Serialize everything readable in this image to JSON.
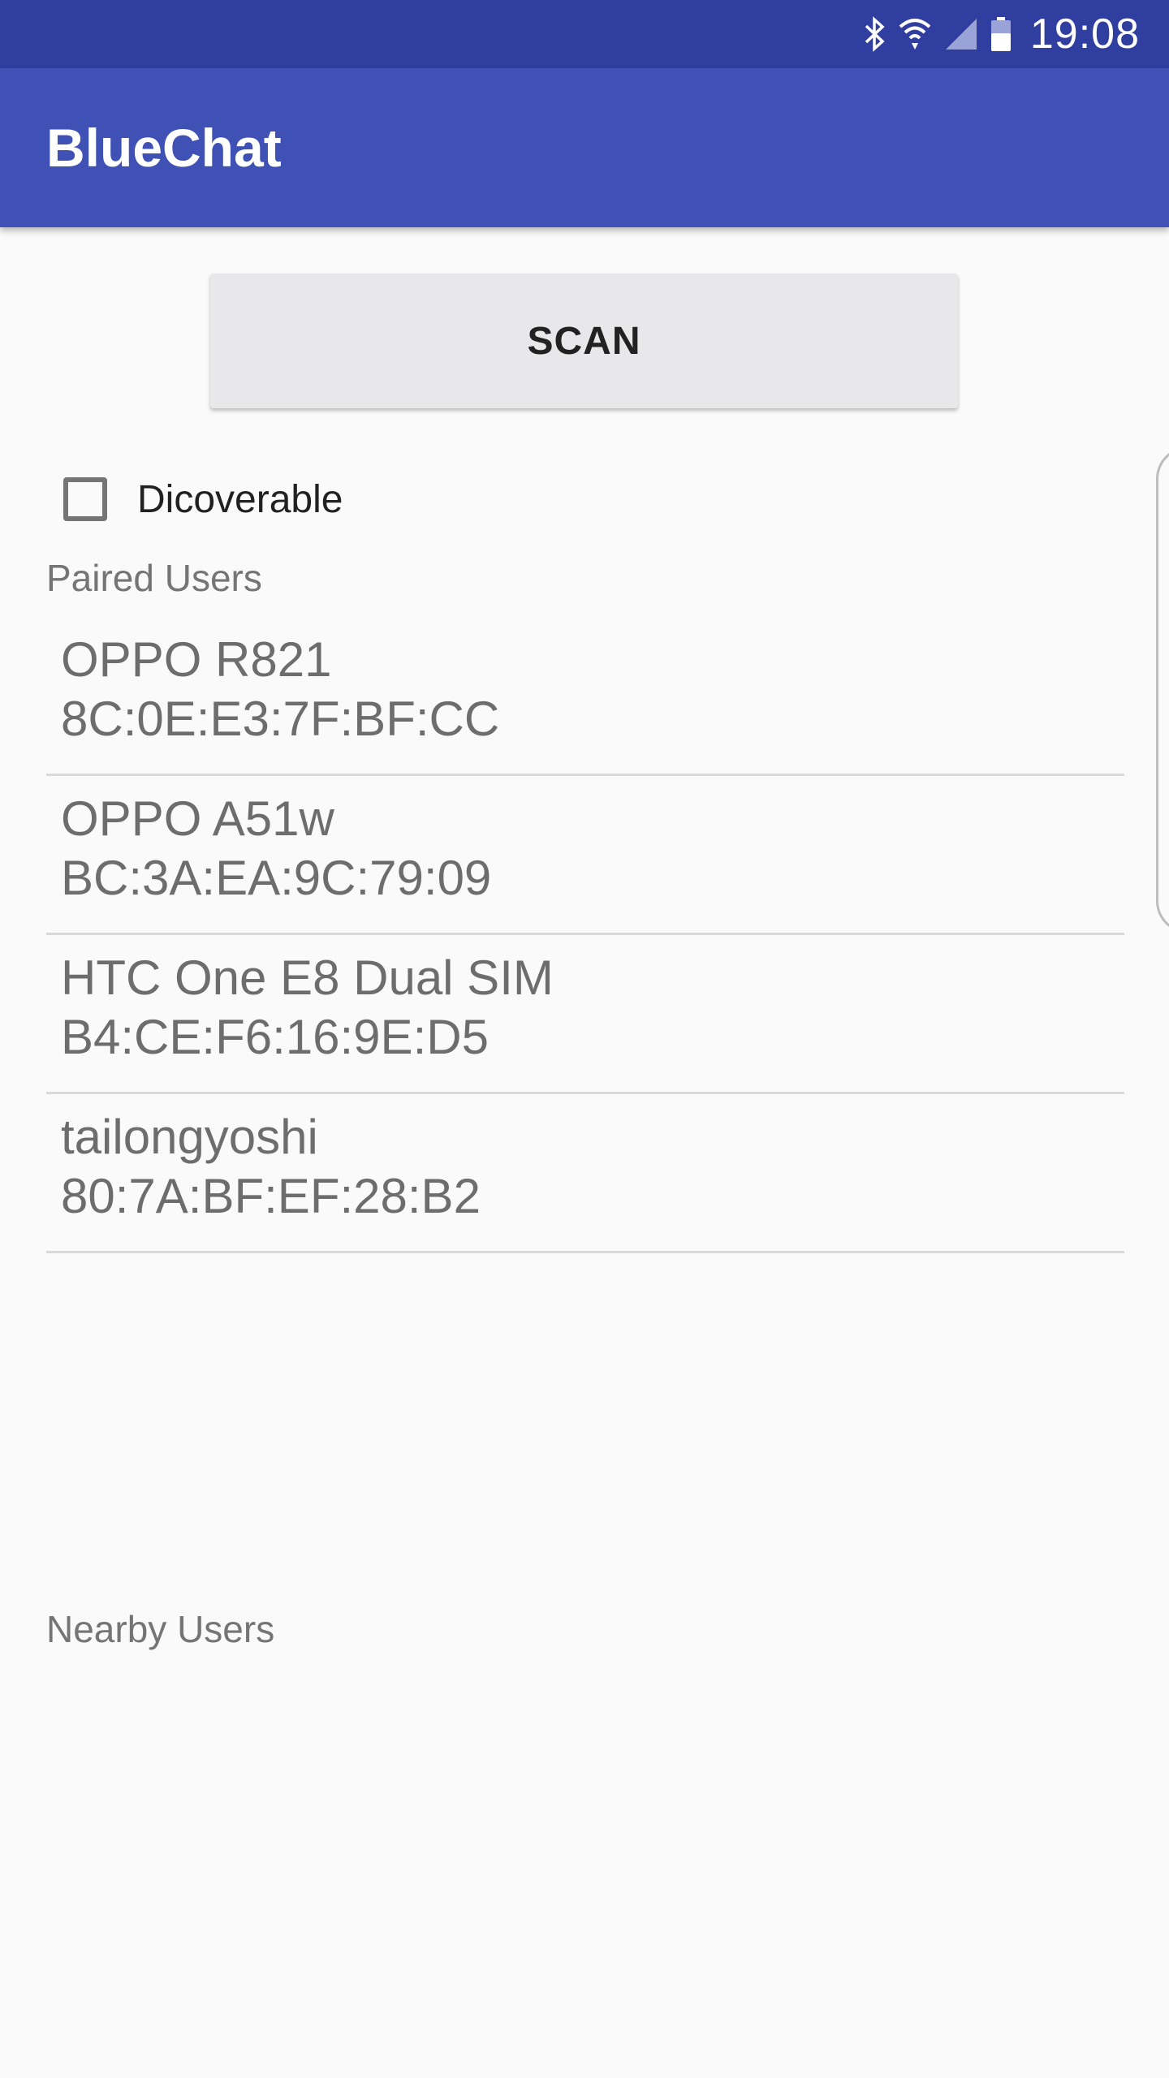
{
  "status_bar": {
    "time": "19:08",
    "icons": [
      "bluetooth-icon",
      "wifi-icon",
      "cell-signal-icon",
      "battery-icon"
    ],
    "background": "#303f9f"
  },
  "app_bar": {
    "title": "BlueChat",
    "background": "#3f51b5"
  },
  "scan_button": {
    "label": "SCAN"
  },
  "discoverable": {
    "label": "Dicoverable",
    "checked": false
  },
  "paired_section": {
    "label": "Paired Users",
    "devices": [
      {
        "name": "OPPO R821",
        "mac": "8C:0E:E3:7F:BF:CC"
      },
      {
        "name": "OPPO A51w",
        "mac": "BC:3A:EA:9C:79:09"
      },
      {
        "name": "HTC One E8 Dual SIM",
        "mac": "B4:CE:F6:16:9E:D5"
      },
      {
        "name": "tailongyoshi",
        "mac": "80:7A:BF:EF:28:B2"
      }
    ]
  },
  "nearby_section": {
    "label": "Nearby Users",
    "devices": []
  }
}
